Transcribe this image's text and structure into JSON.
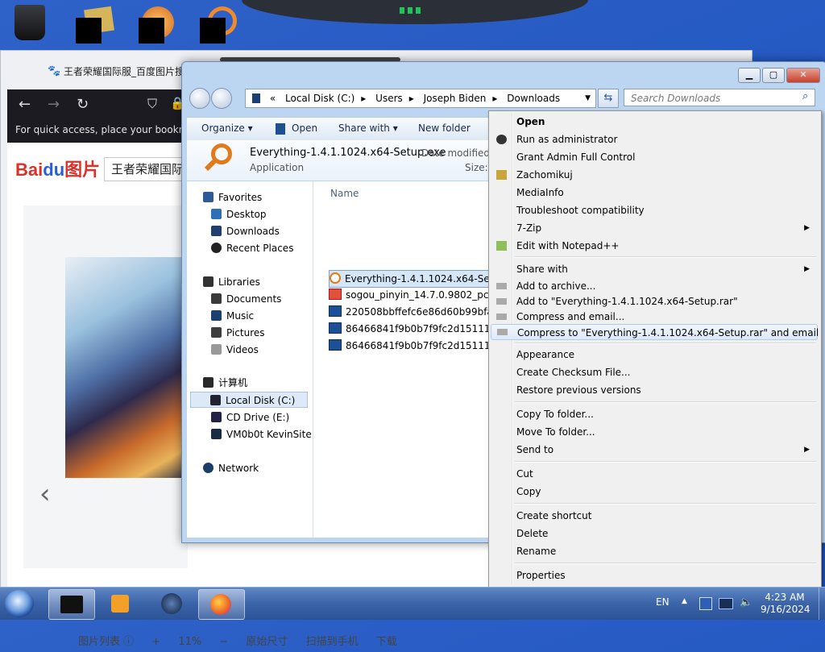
{
  "desktop": {
    "icons": [
      {
        "name": "recycle-bin"
      },
      {
        "name": "redacted-app-1"
      },
      {
        "name": "redacted-app-2"
      },
      {
        "name": "redacted-app-3"
      }
    ]
  },
  "browser": {
    "tab_title": "王者荣耀国际服_百度图片搜",
    "bookmarks_hint": "For quick access, place your bookmarks",
    "logo": "Bai度图片",
    "logo_text_a": "Bai",
    "logo_text_b": "du",
    "logo_text_c": "图片",
    "search_value": "王者荣耀国际",
    "bottom": {
      "list": "图片列表 ⓘ",
      "zoom_in": "+",
      "zoom": "11%",
      "zoom_out": "−",
      "original": "原始尺寸",
      "scan": "扫描到手机",
      "download": "下载"
    }
  },
  "explorer": {
    "breadcrumb": {
      "prefix": "«",
      "parts": [
        "Local Disk (C:)",
        "Users",
        "Joseph Biden",
        "Downloads"
      ]
    },
    "search_placeholder": "Search Downloads",
    "commands": {
      "organize": "Organize ▾",
      "open": "Open",
      "share": "Share with ▾",
      "new_folder": "New folder"
    },
    "details": {
      "filename": "Everything-1.4.1.1024.x64-Setup.exe",
      "type": "Application",
      "modified_label": "Date modified:",
      "size_label": "Size:"
    },
    "nav": {
      "favorites": "Favorites",
      "desktop": "Desktop",
      "downloads": "Downloads",
      "recent": "Recent Places",
      "libraries": "Libraries",
      "documents": "Documents",
      "music": "Music",
      "pictures": "Pictures",
      "videos": "Videos",
      "computer": "计算机",
      "local_disk": "Local Disk (C:)",
      "cd_drive": "CD Drive (E:)",
      "vm": "VM0b0t KevinSite",
      "network": "Network"
    },
    "column_name": "Name",
    "files": [
      "Everything-1.4.1.1024.x64-Setup.exe",
      "sogou_pinyin_14.7.0.9802_pc004.exe",
      "220508bbffefc6e86d60b99bfa046c",
      "86466841f9b0b7f9fc2d15111a907e",
      "86466841f9b0b7f9fc2d15111a907e"
    ]
  },
  "context_menu": {
    "open": "Open",
    "run_admin": "Run as administrator",
    "grant": "Grant Admin Full Control",
    "zachomikuj": "Zachomikuj",
    "mediainfo": "MediaInfo",
    "troubleshoot": "Troubleshoot compatibility",
    "sevenzip": "7-Zip",
    "notepad": "Edit with Notepad++",
    "share_with": "Share with",
    "add_archive": "Add to archive...",
    "add_rar": "Add to \"Everything-1.4.1.1024.x64-Setup.rar\"",
    "compress_email": "Compress and email...",
    "compress_rar_email": "Compress to \"Everything-1.4.1.1024.x64-Setup.rar\" and email",
    "appearance": "Appearance",
    "checksum": "Create Checksum File...",
    "restore": "Restore previous versions",
    "copy_to": "Copy To folder...",
    "move_to": "Move To folder...",
    "send_to": "Send to",
    "cut": "Cut",
    "copy": "Copy",
    "shortcut": "Create shortcut",
    "delete": "Delete",
    "rename": "Rename",
    "properties": "Properties"
  },
  "taskbar": {
    "lang": "EN",
    "time": "4:23 AM",
    "date": "9/16/2024"
  },
  "colors": {
    "accent": "#2458c2",
    "menu_highlight": "#dde9f9",
    "taskbar": "#3b63a8"
  }
}
